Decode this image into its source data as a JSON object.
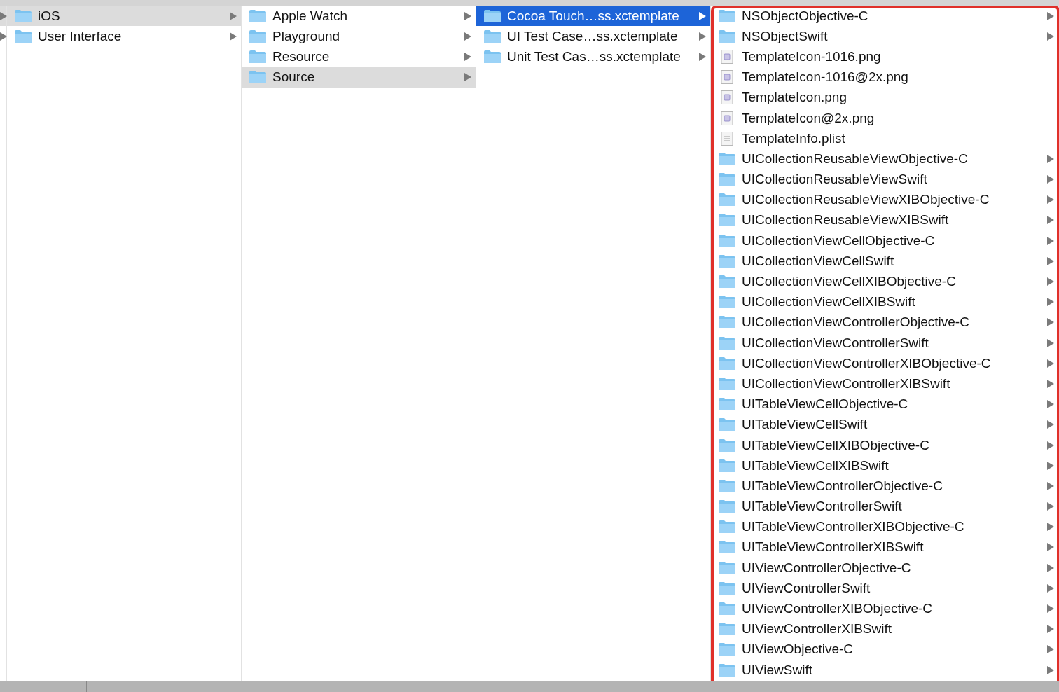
{
  "columns": [
    {
      "focused": false,
      "items": [
        {
          "kind": "folder",
          "selected": true
        },
        {
          "kind": "folder",
          "selected": false
        }
      ]
    },
    {
      "focused": false,
      "items": [
        {
          "kind": "folder",
          "label": "iOS",
          "selected": true
        },
        {
          "kind": "folder",
          "label": "User Interface",
          "selected": false
        }
      ]
    },
    {
      "focused": false,
      "items": [
        {
          "kind": "folder",
          "label": "Apple Watch",
          "selected": false
        },
        {
          "kind": "folder",
          "label": "Playground",
          "selected": false
        },
        {
          "kind": "folder",
          "label": "Resource",
          "selected": false
        },
        {
          "kind": "folder",
          "label": "Source",
          "selected": true
        }
      ]
    },
    {
      "focused": true,
      "items": [
        {
          "kind": "folder",
          "label": "Cocoa Touch…ss.xctemplate",
          "selected": true
        },
        {
          "kind": "folder",
          "label": "UI Test Case…ss.xctemplate",
          "selected": false
        },
        {
          "kind": "folder",
          "label": "Unit Test Cas…ss.xctemplate",
          "selected": false
        }
      ]
    },
    {
      "items": [
        {
          "kind": "folder",
          "label": "NSObjectObjective-C",
          "selected": false
        },
        {
          "kind": "folder",
          "label": "NSObjectSwift",
          "selected": false
        },
        {
          "kind": "image",
          "label": "TemplateIcon-1016.png",
          "selected": false
        },
        {
          "kind": "image",
          "label": "TemplateIcon-1016@2x.png",
          "selected": false
        },
        {
          "kind": "image",
          "label": "TemplateIcon.png",
          "selected": false
        },
        {
          "kind": "image",
          "label": "TemplateIcon@2x.png",
          "selected": false
        },
        {
          "kind": "plist",
          "label": "TemplateInfo.plist",
          "selected": false
        },
        {
          "kind": "folder",
          "label": "UICollectionReusableViewObjective-C",
          "selected": false
        },
        {
          "kind": "folder",
          "label": "UICollectionReusableViewSwift",
          "selected": false
        },
        {
          "kind": "folder",
          "label": "UICollectionReusableViewXIBObjective-C",
          "selected": false
        },
        {
          "kind": "folder",
          "label": "UICollectionReusableViewXIBSwift",
          "selected": false
        },
        {
          "kind": "folder",
          "label": "UICollectionViewCellObjective-C",
          "selected": false
        },
        {
          "kind": "folder",
          "label": "UICollectionViewCellSwift",
          "selected": false
        },
        {
          "kind": "folder",
          "label": "UICollectionViewCellXIBObjective-C",
          "selected": false
        },
        {
          "kind": "folder",
          "label": "UICollectionViewCellXIBSwift",
          "selected": false
        },
        {
          "kind": "folder",
          "label": "UICollectionViewControllerObjective-C",
          "selected": false
        },
        {
          "kind": "folder",
          "label": "UICollectionViewControllerSwift",
          "selected": false
        },
        {
          "kind": "folder",
          "label": "UICollectionViewControllerXIBObjective-C",
          "selected": false
        },
        {
          "kind": "folder",
          "label": "UICollectionViewControllerXIBSwift",
          "selected": false
        },
        {
          "kind": "folder",
          "label": "UITableViewCellObjective-C",
          "selected": false
        },
        {
          "kind": "folder",
          "label": "UITableViewCellSwift",
          "selected": false
        },
        {
          "kind": "folder",
          "label": "UITableViewCellXIBObjective-C",
          "selected": false
        },
        {
          "kind": "folder",
          "label": "UITableViewCellXIBSwift",
          "selected": false
        },
        {
          "kind": "folder",
          "label": "UITableViewControllerObjective-C",
          "selected": false
        },
        {
          "kind": "folder",
          "label": "UITableViewControllerSwift",
          "selected": false
        },
        {
          "kind": "folder",
          "label": "UITableViewControllerXIBObjective-C",
          "selected": false
        },
        {
          "kind": "folder",
          "label": "UITableViewControllerXIBSwift",
          "selected": false
        },
        {
          "kind": "folder",
          "label": "UIViewControllerObjective-C",
          "selected": false
        },
        {
          "kind": "folder",
          "label": "UIViewControllerSwift",
          "selected": false
        },
        {
          "kind": "folder",
          "label": "UIViewControllerXIBObjective-C",
          "selected": false
        },
        {
          "kind": "folder",
          "label": "UIViewControllerXIBSwift",
          "selected": false
        },
        {
          "kind": "folder",
          "label": "UIViewObjective-C",
          "selected": false
        },
        {
          "kind": "folder",
          "label": "UIViewSwift",
          "selected": false
        }
      ]
    }
  ]
}
